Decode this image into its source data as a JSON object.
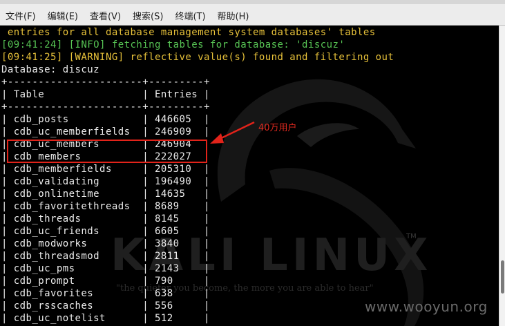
{
  "menu": {
    "items": [
      "文件(F)",
      "编辑(E)",
      "查看(V)",
      "搜索(S)",
      "终端(T)",
      "帮助(H)"
    ]
  },
  "terminal": {
    "lines": [
      {
        "cls": "y",
        "text": " entries for all database management system databases' tables"
      },
      {
        "cls": "g",
        "text": "[09:41:24] [INFO] fetching tables for database: 'discuz'"
      },
      {
        "cls": "y",
        "text": "[09:41:25] [WARNING] reflective value(s) found and filtering out"
      },
      {
        "cls": "w",
        "text": "Database: discuz"
      },
      {
        "cls": "w",
        "text": "+----------------------+---------+"
      },
      {
        "cls": "w",
        "text": "| Table                | Entries |"
      },
      {
        "cls": "w",
        "text": "+----------------------+---------+"
      },
      {
        "cls": "w",
        "text": "| cdb_posts            | 446605  |"
      },
      {
        "cls": "w",
        "text": "| cdb_uc_memberfields  | 246909  |"
      },
      {
        "cls": "w",
        "text": "| cdb_uc_members       | 246904  |"
      },
      {
        "cls": "w",
        "text": "| cdb_members          | 222027  |"
      },
      {
        "cls": "w",
        "text": "| cdb_memberfields     | 205310  |"
      },
      {
        "cls": "w",
        "text": "| cdb_validating       | 196490  |"
      },
      {
        "cls": "w",
        "text": "| cdb_onlinetime       | 14635   |"
      },
      {
        "cls": "w",
        "text": "| cdb_favoritethreads  | 8689    |"
      },
      {
        "cls": "w",
        "text": "| cdb_threads          | 8145    |"
      },
      {
        "cls": "w",
        "text": "| cdb_uc_friends       | 6605    |"
      },
      {
        "cls": "w",
        "text": "| cdb_modworks         | 3840    |"
      },
      {
        "cls": "w",
        "text": "| cdb_threadsmod       | 2811    |"
      },
      {
        "cls": "w",
        "text": "| cdb_uc_pms           | 2143    |"
      },
      {
        "cls": "w",
        "text": "| cdb_prompt           | 790     |"
      },
      {
        "cls": "w",
        "text": "| cdb_favorites        | 638     |"
      },
      {
        "cls": "w",
        "text": "| cdb_rsscaches        | 556     |"
      },
      {
        "cls": "w",
        "text": "| cdb_uc_notelist      | 512     |"
      }
    ]
  },
  "annotation": {
    "text": "40万用户",
    "color": "#e2231a"
  },
  "background": {
    "logo": "KALI LINUX",
    "tm": "TM",
    "motto": "\"the quieter you become, the more you are able to hear\""
  },
  "watermark": "www.wooyun.org",
  "colors": {
    "warning": "#e8c23a",
    "info": "#57c454",
    "text": "#ececec",
    "background": "#000000"
  }
}
